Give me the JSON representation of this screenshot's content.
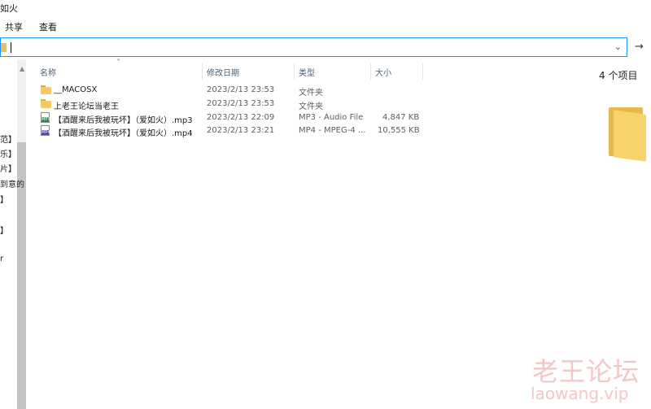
{
  "window": {
    "title_fragment": "如火"
  },
  "ribbon": {
    "tabs": [
      "共享",
      "查看"
    ]
  },
  "address": {
    "value": "",
    "dropdown_icon": "chevron-down-icon",
    "go_icon": "arrow-right-icon"
  },
  "nav_pane": {
    "items": [
      "范】",
      "乐】",
      "片】",
      "到意的",
      "】",
      "】",
      "r"
    ]
  },
  "columns": {
    "name": "名称",
    "modified": "修改日期",
    "type": "类型",
    "size": "大小"
  },
  "files": [
    {
      "name": "__MACOSX",
      "modified": "2023/2/13 23:53",
      "type": "文件夹",
      "size": "",
      "icon": "folder-icon"
    },
    {
      "name": "上老王论坛当老王",
      "modified": "2023/2/13 23:53",
      "type": "文件夹",
      "size": "",
      "icon": "folder-icon"
    },
    {
      "name": "【酒醒来后我被玩坏】（爱如火）.mp3",
      "modified": "2023/2/13 22:09",
      "type": "MP3 - Audio File",
      "size": "4,847 KB",
      "icon": "mp3-file-icon",
      "badge": "MP3"
    },
    {
      "name": "【酒醒来后我被玩坏】（爱如火）.mp4",
      "modified": "2023/2/13 23:21",
      "type": "MP4 - MPEG-4 ...",
      "size": "10,555 KB",
      "icon": "mp4-file-icon",
      "badge": "MP4"
    }
  ],
  "preview": {
    "count_label": "4 个项目"
  },
  "watermark": {
    "cn": "老王论坛",
    "en": "laowang.vip"
  },
  "colors": {
    "accent_border": "#1e90ff",
    "folder": "#f2cc63",
    "mp3_icon": "#2e8b57",
    "mp4_icon": "#5a3ec8",
    "watermark": "#f4c7c7"
  }
}
